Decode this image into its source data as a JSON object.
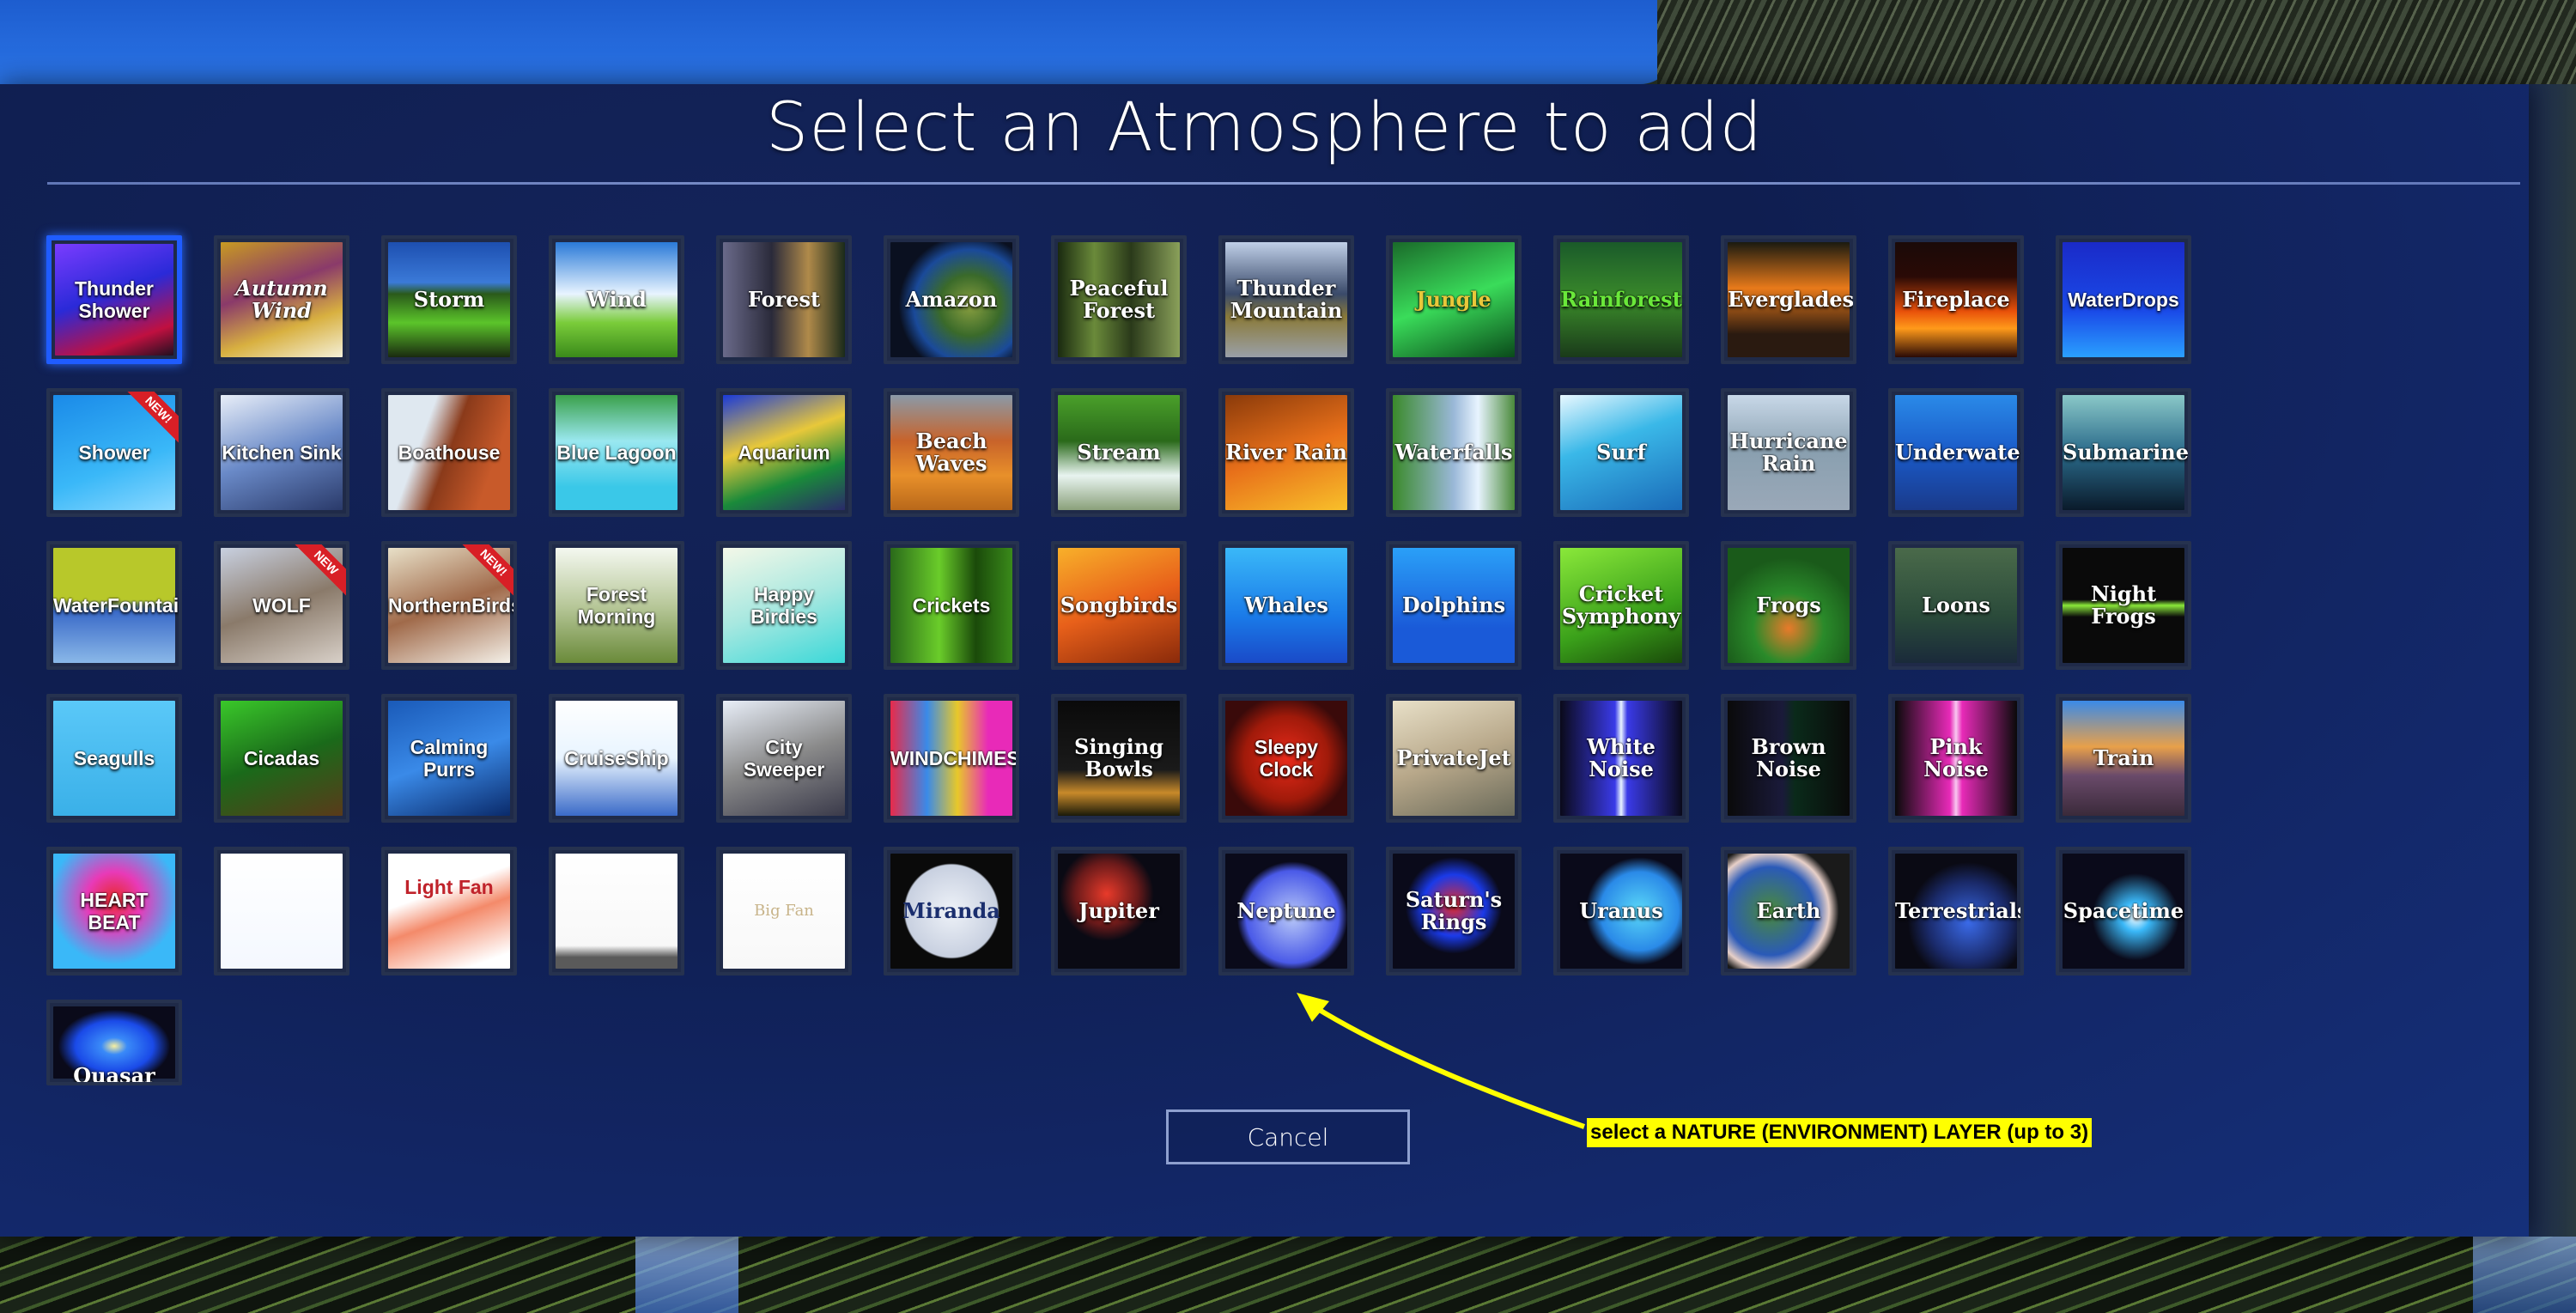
{
  "dialog": {
    "title": "Select an Atmosphere to add",
    "cancel_label": "Cancel"
  },
  "annotation": {
    "text": "select a NATURE (ENVIRONMENT) LAYER (up to 3)",
    "color": "#ffff00"
  },
  "colors": {
    "panel": "#12245e",
    "selection": "#1f5cff"
  },
  "tiles": [
    {
      "label": "Thunder Shower",
      "selected": true,
      "style": "sans",
      "bg": "linear-gradient(160deg,#7a3cff,#2a2ad8 45%,#c01040 80%,#201020)"
    },
    {
      "label": "Autumn Wind",
      "style": "script",
      "bg": "linear-gradient(160deg,#c89a22,#8a3a6a 40%,#d8b040 70%,#f4f0d8)"
    },
    {
      "label": "Storm",
      "bg": "linear-gradient(180deg,#1d4fb0 0%,#3b7ad8 35%,#2a5a1a 45%,#5bc42a 70%,#1a2a10)"
    },
    {
      "label": "Wind",
      "bg": "linear-gradient(180deg,#2a7ad8,#e8f4ff 45%,#7acc3a 70%,#3a8a1a)"
    },
    {
      "label": "Forest",
      "bg": "linear-gradient(90deg,#6a6a8a,#2a2a3a 40%,#b08a4a 70%,#1a2a1a)"
    },
    {
      "label": "Amazon",
      "bg": "radial-gradient(circle at 65% 55%,#8aa040 0,#3a6a2a 30%,#1a4a9a 55%,#0a1020 70%)"
    },
    {
      "label": "Peaceful Forest",
      "bg": "linear-gradient(90deg,#1a2a10,#6a8a3a 30%,#2a3a1a 60%,#8aa05a)"
    },
    {
      "label": "Thunder Mountain",
      "bg": "linear-gradient(180deg,#c0d0e8,#3a4a6a 45%,#8a7a3a 65%,#9aa0a8)"
    },
    {
      "label": "Jungle",
      "style": "gold",
      "bg": "linear-gradient(160deg,#1a6a2a,#3adc5a 50%,#0a4a1a)"
    },
    {
      "label": "Rainforest",
      "style": "green",
      "bg": "linear-gradient(180deg,#1a5a2a,#3a8a2a 50%,#1a3a1a)"
    },
    {
      "label": "Everglades",
      "bg": "linear-gradient(180deg,#1a1a10,#e87a1a 40%,#2a1a10 80%)"
    },
    {
      "label": "Fireplace",
      "bg": "linear-gradient(180deg,#1a0a08,#2a0a06 30%,#e8500a 60%,#ff9a1a 75%,#2a0a06)"
    },
    {
      "label": "WaterDrops",
      "style": "sans",
      "bg": "linear-gradient(180deg,#1a2ac8,#1a4ae8 60%,#2aa0ff)"
    },
    {
      "label": "Shower",
      "badge": "NEW!",
      "style": "sans",
      "bg": "linear-gradient(160deg,#1a8ae8,#3ab8f8 60%,#8ad8ff)"
    },
    {
      "label": "Kitchen Sink",
      "style": "sans",
      "bg": "linear-gradient(160deg,#e8eef8,#6a8ac8 50%,#2a3a6a)"
    },
    {
      "label": "Boathouse",
      "style": "sans",
      "bg": "linear-gradient(110deg,#dfe8f0 0,#dfe8f0 30%,#8a3a1a 50%,#c85a2a 80%)"
    },
    {
      "label": "Blue Lagoon",
      "style": "sans",
      "bg": "linear-gradient(180deg,#3aa04a,#9ae8f0 40%,#3ac8e8 80%)"
    },
    {
      "label": "Aquarium",
      "style": "sans",
      "bg": "linear-gradient(160deg,#1a3ad8,#e8c83a 40%,#1a8a3a 70%,#2a2a6a)"
    },
    {
      "label": "Beach Waves",
      "bg": "linear-gradient(180deg,#8a9aa8,#c8632a 40%,#e8902a 70%,#b8681a)"
    },
    {
      "label": "Stream",
      "bg": "linear-gradient(180deg,#4aa02a,#2a6a1a 40%,#e8f4f0 70%,#8aa07a)"
    },
    {
      "label": "River Rain",
      "bg": "linear-gradient(160deg,#8a3a0a,#e8701a 50%,#f8c02a)"
    },
    {
      "label": "Waterfalls",
      "bg": "linear-gradient(90deg,#3a8a2a,#9ab8d8 50%,#e8f4ff 70%,#4a8a3a)"
    },
    {
      "label": "Surf",
      "bg": "linear-gradient(160deg,#e8f8ff,#3ab8e8 40%,#1a6ab8)"
    },
    {
      "label": "Hurricane Rain",
      "bg": "linear-gradient(180deg,#c8d8e8,#8aa0b0 50%,#9aa8b8)"
    },
    {
      "label": "Underwater",
      "bg": "linear-gradient(180deg,#2a8ae8,#1a5ac8 50%,#1a3a8a)"
    },
    {
      "label": "Submarine",
      "bg": "linear-gradient(180deg,#8ac8c8,#2a6a8a 50%,#0a1a2a)"
    },
    {
      "label": "WaterFountain",
      "style": "sans",
      "bg": "linear-gradient(180deg,#b8c82a 0,#b8c82a 45%,#3a6ac8 55%,#8ab8e8)"
    },
    {
      "label": "WOLF",
      "badge": "NEW",
      "style": "sans",
      "bg": "linear-gradient(160deg,#c8d0e0,#8a7a6a 50%,#d8d0c8)"
    },
    {
      "label": "NorthernBirds",
      "badge": "NEW!",
      "style": "sans",
      "bg": "linear-gradient(160deg,#e8e0c8,#a06a4a 50%,#f4f0e8)"
    },
    {
      "label": "Forest Morning",
      "style": "sans",
      "bg": "linear-gradient(180deg,#f4f8f0,#b8c89a 50%,#6a8a3a)"
    },
    {
      "label": "Happy Birdies",
      "style": "sans",
      "bg": "linear-gradient(160deg,#f4f8e8,#a8e8e0 50%,#3ad8d8)"
    },
    {
      "label": "Crickets",
      "style": "sans",
      "bg": "linear-gradient(90deg,#2a6a1a,#6acc2a 40%,#1a4a0a 70%,#3a8a1a)"
    },
    {
      "label": "Songbirds",
      "bg": "linear-gradient(160deg,#f8b02a,#e8601a 50%,#8a2a0a)"
    },
    {
      "label": "Whales",
      "bg": "linear-gradient(180deg,#3ab8f8,#1a7ae8 60%,#1a4ac8)"
    },
    {
      "label": "Dolphins",
      "bg": "linear-gradient(180deg,#2aa0f8,#1a5ad8 70%)"
    },
    {
      "label": "Cricket Symphony",
      "bg": "linear-gradient(160deg,#8ae83a,#3aa01a 60%,#1a4a0a)"
    },
    {
      "label": "Frogs",
      "bg": "radial-gradient(circle at 50% 70%,#e87a2a 0,#2a8a2a 35%,#1a5a1a 70%)"
    },
    {
      "label": "Loons",
      "bg": "linear-gradient(180deg,#4a6a4a,#2a4a3a 60%,#1a2a3a)"
    },
    {
      "label": "Night Frogs",
      "bg": "linear-gradient(180deg,#0a0a0a 0,#0a0a0a 45%,#8ae83a 50%,#0a0a0a 60%)"
    },
    {
      "label": "Seagulls",
      "style": "sans",
      "bg": "linear-gradient(180deg,#5ac8f8,#3ab0e8)"
    },
    {
      "label": "Cicadas",
      "style": "sans",
      "bg": "linear-gradient(160deg,#3ac82a,#1a6a1a 50%,#5a3a1a)"
    },
    {
      "label": "Calming Purrs",
      "style": "sans",
      "bg": "linear-gradient(160deg,#1a5ab8,#3a8ae8 50%,#0a2a6a)"
    },
    {
      "label": "CruiseShip",
      "style": "sans",
      "bg": "linear-gradient(180deg,#ffffff,#e8f4ff 50%,#3a6ac8)"
    },
    {
      "label": "City Sweeper",
      "style": "sans",
      "bg": "linear-gradient(160deg,#e8eef8,#8a8a8a 50%,#3a3a4a)"
    },
    {
      "label": "WINDCHIMES",
      "style": "sans",
      "bg": "linear-gradient(90deg,#e82a4a,#3a8ae8 30%,#e8c82a 55%,#e82ab8 80%)"
    },
    {
      "label": "Singing Bowls",
      "bg": "linear-gradient(180deg,#0a0a0a 0,#1a1a1a 60%,#c88a2a 80%,#1a1a0a)"
    },
    {
      "label": "Sleepy Clock",
      "style": "sans",
      "bg": "radial-gradient(circle,#e82a1a 0,#a01a0a 50%,#3a0a0a 75%)"
    },
    {
      "label": "PrivateJet",
      "bg": "linear-gradient(160deg,#e8e0c8,#b8a88a 50%,#6a6a5a)"
    },
    {
      "label": "White Noise",
      "bg": "linear-gradient(90deg,#0a0a1a,#3a3ae8 45%,#e8f4ff 50%,#3a3ae8 55%,#0a0a1a)"
    },
    {
      "label": "Brown Noise",
      "bg": "linear-gradient(90deg,#0a0a0a,#1a1a3a 45%,#0a2a1a 55%,#0a0a0a)"
    },
    {
      "label": "Pink Noise",
      "bg": "linear-gradient(90deg,#0a0a0a,#e82ab8 45%,#f8c8f0 50%,#e82ab8 55%,#0a0a0a)"
    },
    {
      "label": "Train",
      "bg": "linear-gradient(180deg,#3a8ae8,#e8a04a 40%,#6a4a6a 65%,#3a2a3a)"
    },
    {
      "label": "HEART BEAT",
      "style": "sans",
      "bg": "radial-gradient(circle at 50% 40%,#e82a2a 0,#e83ab8 30%,#3ab8f8 70%)"
    },
    {
      "label": "",
      "style": "blank",
      "bg": "linear-gradient(180deg,#ffffff,#f4f8ff)"
    },
    {
      "label": "Light Fan",
      "style": "red",
      "bg": "linear-gradient(160deg,#ffffff 0,#ffffff 35%,#f48a6a 55%,#ffffff 90%)"
    },
    {
      "label": "",
      "style": "blank",
      "bg": "linear-gradient(180deg,#ffffff 0,#f8f8f8 80%,#5a5a5a 90%)"
    },
    {
      "label": "Big Fan",
      "style": "faint",
      "bg": "linear-gradient(180deg,#ffffff,#f8f8f8)"
    },
    {
      "label": "Miranda",
      "style": "dark",
      "bg": "radial-gradient(circle,#eef2f8 0,#c8d0e0 55%,#0a0a0a 57%)"
    },
    {
      "label": "Jupiter",
      "bg": "radial-gradient(circle at 40% 35%,#e83a2a 0,#6a1a1a 30%,#0a0a14 45%)"
    },
    {
      "label": "Neptune",
      "bg": "radial-gradient(circle at 55% 55%,#b8c8f8 0,#4a5ae8 50%,#0a0a1a 60%)"
    },
    {
      "label": "Saturn's Rings",
      "bg": "radial-gradient(circle at 50% 45%,#e82a2a 0,#1a3ae8 35%,#0a0a1a 55%)"
    },
    {
      "label": "Uranus",
      "bg": "radial-gradient(circle at 65% 50%,#5ad8f8 0,#2a8ae8 40%,#0a0a1a 55%)"
    },
    {
      "label": "Earth",
      "bg": "radial-gradient(circle at 35% 50%,#4a8a3a 0,#2a5ab8 45%,#e8d0c8 60%,#1a1a1a 70%)"
    },
    {
      "label": "Terrestrials",
      "bg": "radial-gradient(circle at 60% 60%,#3a6ae8 0,#1a2a6a 40%,#0a0a14 60%)"
    },
    {
      "label": "Spacetime",
      "bg": "radial-gradient(circle at 60% 55%,#ffffff 0,#3ab8f8 15%,#0a0a1a 45%)"
    },
    {
      "label": "Quasar",
      "bg": "radial-gradient(ellipse at 50% 55%,#f8f0a0 0,#3a8af8 15%,#1a4ae8 45%,#0a0a1a 65%)",
      "partial": true
    }
  ]
}
